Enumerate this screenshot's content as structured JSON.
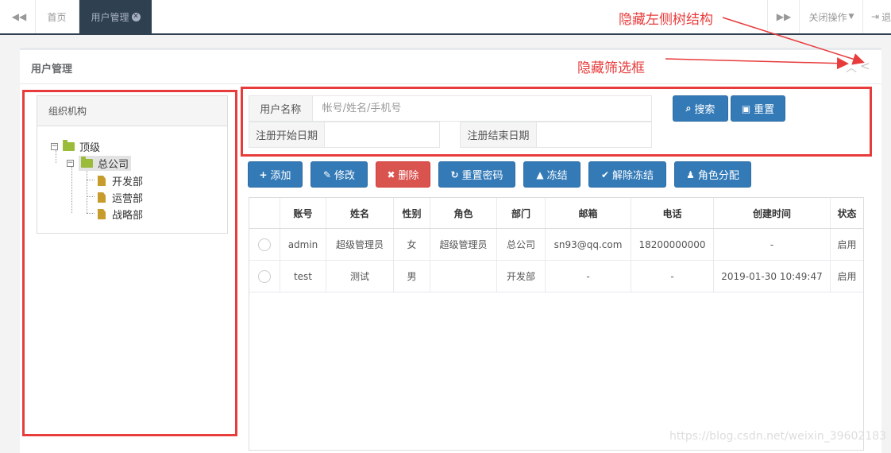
{
  "tabs": {
    "home": "首页",
    "active": "用户管理",
    "close_ops": "关闭操作",
    "exit": "退"
  },
  "panel": {
    "title": "用户管理"
  },
  "annotations": {
    "hide_tree": "隐藏左侧树结构",
    "hide_filter": "隐藏筛选框",
    "color": "#e83c3c"
  },
  "tree": {
    "title": "组织机构",
    "root": "顶级",
    "company": "总公司",
    "children": [
      "开发部",
      "运营部",
      "战略部"
    ]
  },
  "search": {
    "username_label": "用户名称",
    "username_placeholder": "帐号/姓名/手机号",
    "start_date_label": "注册开始日期",
    "end_date_label": "注册结束日期",
    "search_btn": "搜索",
    "reset_btn": "重置"
  },
  "toolbar": {
    "add": "添加",
    "edit": "修改",
    "delete": "删除",
    "reset_pwd": "重置密码",
    "freeze": "冻结",
    "unfreeze": "解除冻结",
    "assign_role": "角色分配"
  },
  "table": {
    "headers": [
      "账号",
      "姓名",
      "性别",
      "角色",
      "部门",
      "邮箱",
      "电话",
      "创建时间",
      "状态"
    ],
    "rows": [
      [
        "admin",
        "超级管理员",
        "女",
        "超级管理员",
        "总公司",
        "sn93@qq.com",
        "18200000000",
        "-",
        "启用"
      ],
      [
        "test",
        "测试",
        "男",
        "",
        "开发部",
        "-",
        "-",
        "2019-01-30 10:49:47",
        "启用"
      ]
    ]
  },
  "watermark": "https://blog.csdn.net/weixin_39602183",
  "colors": {
    "primary": "#337ab7",
    "danger": "#d9534f",
    "nav_dark": "#2f4050"
  }
}
